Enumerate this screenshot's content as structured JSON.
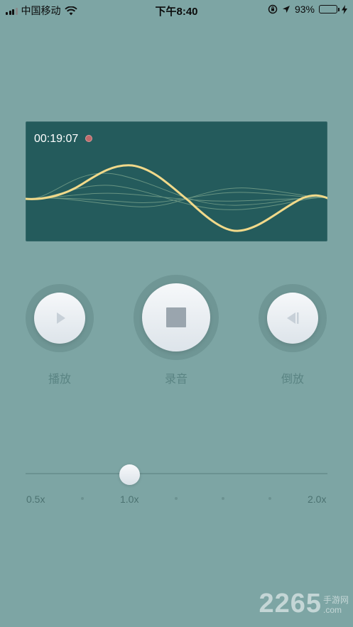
{
  "status_bar": {
    "carrier": "中国移动",
    "time": "下午8:40",
    "battery_percent": "93%",
    "battery_level": 0.93,
    "icons": [
      "signal-icon",
      "wifi-icon",
      "lock-rotation-icon",
      "location-icon",
      "battery-icon",
      "charging-icon"
    ]
  },
  "recorder": {
    "elapsed": "00:19:07",
    "recording_indicator_color": "#c0696a",
    "wave_color": "#f1d98a"
  },
  "controls": {
    "play_label": "播放",
    "record_label": "录音",
    "reverse_label": "倒放"
  },
  "speed": {
    "value": 1.0,
    "min": 0.5,
    "max": 2.0,
    "labels": {
      "min": "0.5x",
      "current": "1.0x",
      "max": "2.0x"
    }
  },
  "watermark": {
    "number": "2265",
    "suffix_top": "手游网",
    "suffix_bottom": ".com"
  },
  "colors": {
    "background": "#7da5a4",
    "panel": "#245b5c",
    "label": "#5a8483"
  }
}
